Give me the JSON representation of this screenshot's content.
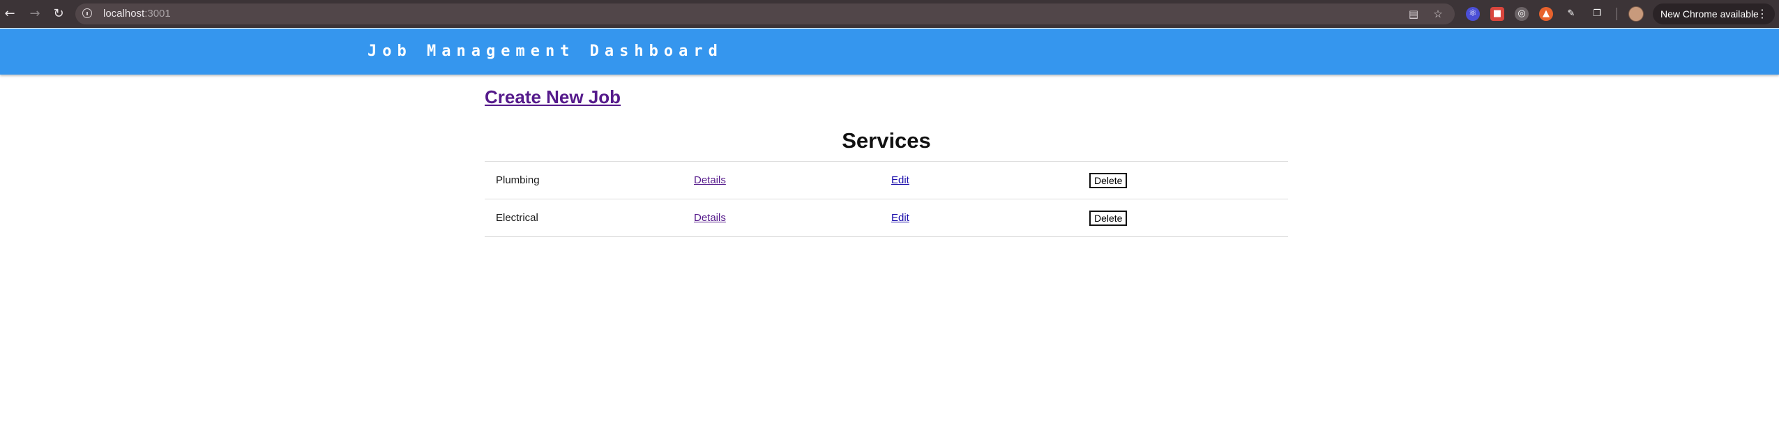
{
  "browser": {
    "url_host": "localhost",
    "url_port": ":3001",
    "update_label": "New Chrome available",
    "icons": {
      "back": "back-arrow-icon",
      "forward": "forward-arrow-icon",
      "reload": "reload-icon",
      "site_info": "info-icon",
      "install": "install-app-icon",
      "bookmark": "star-icon",
      "extensions": "puzzle-icon",
      "menu": "kebab-menu-icon"
    }
  },
  "header": {
    "title": "Job Management Dashboard",
    "background_color": "#3596ee"
  },
  "main": {
    "create_link": "Create New Job",
    "services_title": "Services",
    "rows": [
      {
        "name": "Plumbing",
        "details": "Details",
        "edit": "Edit",
        "delete": "Delete"
      },
      {
        "name": "Electrical",
        "details": "Details",
        "edit": "Edit",
        "delete": "Delete"
      }
    ]
  }
}
